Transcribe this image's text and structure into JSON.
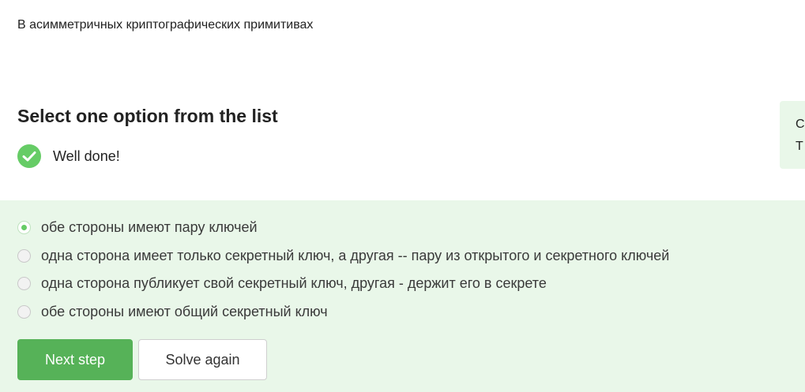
{
  "question": {
    "text": "В асимметричных криптографических примитивах"
  },
  "instruction": {
    "title": "Select one option from the list"
  },
  "feedback": {
    "text": "Well done!",
    "icon": "check-circle-icon",
    "color": "#66cc66"
  },
  "side_card": {
    "line1": "C",
    "line2": "T"
  },
  "options": [
    {
      "label": "обе стороны имеют пару ключей",
      "selected": true
    },
    {
      "label": "одна сторона имеет только секретный ключ, а другая -- пару из открытого и секретного ключей",
      "selected": false
    },
    {
      "label": "одна сторона публикует свой секретный ключ, другая - держит его в секрете",
      "selected": false
    },
    {
      "label": "обе стороны имеют общий секретный ключ",
      "selected": false
    }
  ],
  "buttons": {
    "next_label": "Next step",
    "solve_again_label": "Solve again"
  },
  "colors": {
    "accent": "#56b258",
    "answer_background": "#e9f7e9"
  }
}
